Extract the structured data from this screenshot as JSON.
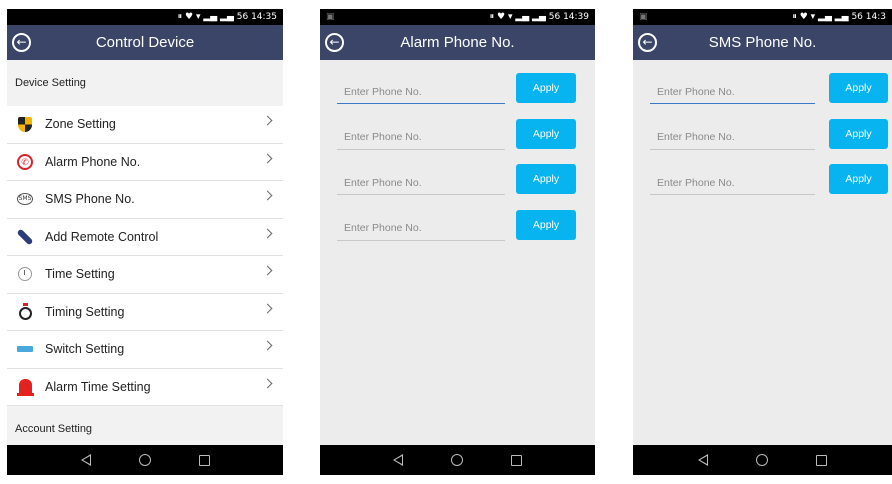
{
  "screens": [
    {
      "status_time": "14:35",
      "status_icons": "⏸ ♥ ▾ ▂▄ ▂▄ 56",
      "title": "Control Device",
      "device_section": "Device Setting",
      "account_section": "Account Setting",
      "items": [
        {
          "label": "Zone Setting",
          "icon": "shield-icon"
        },
        {
          "label": "Alarm Phone No.",
          "icon": "phone-icon"
        },
        {
          "label": "SMS Phone No.",
          "icon": "sms-icon"
        },
        {
          "label": "Add Remote Control",
          "icon": "remote-icon"
        },
        {
          "label": "Time Setting",
          "icon": "clock-icon"
        },
        {
          "label": "Timing Setting",
          "icon": "timer-icon"
        },
        {
          "label": "Switch Setting",
          "icon": "switch-icon"
        },
        {
          "label": "Alarm Time Setting",
          "icon": "alarm-icon"
        }
      ]
    },
    {
      "status_time": "14:39",
      "status_icons": "⏸ ♥ ▾ ▂▄ ▂▄ 56",
      "title": "Alarm Phone No.",
      "placeholder": "Enter Phone No.",
      "apply_label": "Apply",
      "rows": 4
    },
    {
      "status_time": "14:3",
      "status_icons": "⏸ ♥ ▾ ▂▄ ▂▄ 56",
      "title": "SMS Phone No.",
      "placeholder": "Enter Phone No.",
      "apply_label": "Apply",
      "rows": 3
    }
  ],
  "colors": {
    "header": "#3a4568",
    "apply": "#08b4f0",
    "focus_underline": "#3a78c8"
  }
}
